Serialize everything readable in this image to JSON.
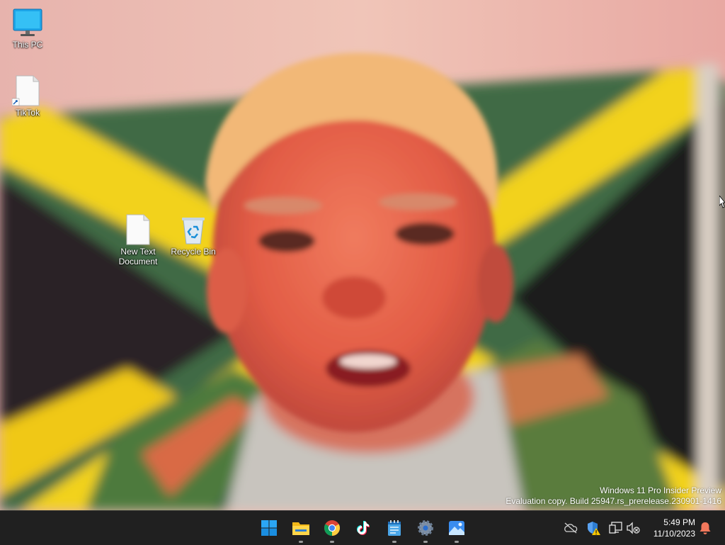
{
  "desktop": {
    "icons": [
      {
        "label": "This PC",
        "icon": "monitor-icon"
      },
      {
        "label": "TikTok",
        "icon": "file-shortcut-icon"
      },
      {
        "label": "New Text Document",
        "icon": "text-file-icon"
      },
      {
        "label": "Recycle Bin",
        "icon": "recycle-bin-icon"
      }
    ],
    "watermark": {
      "line1": "Windows 11 Pro Insider Preview",
      "line2": "Evaluation copy. Build 25947.rs_prerelease.230901-1416"
    }
  },
  "taskbar": {
    "apps": [
      {
        "icon": "windows-start-icon"
      },
      {
        "icon": "file-explorer-icon"
      },
      {
        "icon": "chrome-icon"
      },
      {
        "icon": "tiktok-icon"
      },
      {
        "icon": "notepad-icon"
      },
      {
        "icon": "settings-icon"
      },
      {
        "icon": "photos-icon"
      }
    ],
    "tray": {
      "icons": [
        "onedrive-off-icon",
        "security-warning-icon",
        "network-icon",
        "volume-muted-icon",
        "notification-bell-icon"
      ],
      "time": "5:49 PM",
      "date": "11/10/2023"
    }
  },
  "colors": {
    "taskbar_bg": "#202020",
    "flag_yellow": "#f2d21c",
    "flag_green": "#3f6b45",
    "flag_black": "#1b1a1c",
    "accent_blue": "#0a84d8"
  }
}
